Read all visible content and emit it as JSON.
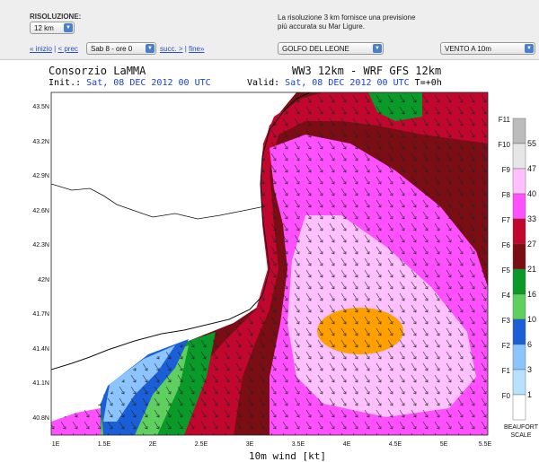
{
  "controls": {
    "resolution_label": "RISOLUZIONE:",
    "resolution_value": "12 km",
    "note_line1": "La risoluzione 3 km fornisce una previsione",
    "note_line2": "più accurata su Mar Ligure.",
    "nav_start": "« inizio",
    "nav_prev": "< prec",
    "time_value": "Sab 8 - ore 0",
    "nav_next": "succ. >",
    "nav_end": "fine»",
    "area_value": "GOLFO DEL LEONE",
    "field_value": "VENTO A 10m"
  },
  "map": {
    "org": "Consorzio LaMMA",
    "model": "WW3 12km - WRF GFS 12km",
    "init_label": "Init.:",
    "init_value": "Sat, 08 DEC 2012   00 UTC",
    "valid_label": "Valid:",
    "valid_value": "Sat, 08 DEC 2012   00 UTC",
    "step": "T=+0h",
    "xlabel": "10m wind [kt]",
    "lat_ticks": [
      "43.5N",
      "43.2N",
      "42.9N",
      "42.6N",
      "42.3N",
      "42N",
      "41.7N",
      "41.4N",
      "41.1N",
      "40.8N"
    ],
    "lon_ticks": [
      "1E",
      "1.5E",
      "2E",
      "2.5E",
      "3E",
      "3.5E",
      "4E",
      "4.5E",
      "5E",
      "5.5E"
    ]
  },
  "legend": {
    "beaufort": [
      "F11",
      "F10",
      "F9",
      "F8",
      "F7",
      "F6",
      "F5",
      "F4",
      "F3",
      "F2",
      "F1",
      "F0"
    ],
    "knots": [
      "55",
      "47",
      "40",
      "33",
      "27",
      "21",
      "16",
      "10",
      "6",
      "3",
      "1"
    ],
    "caption1": "BEAUFORT",
    "caption2": "SCALE",
    "colors": [
      "#bcbcbc",
      "#e6e6e6",
      "#ffc0ff",
      "#ff50ff",
      "#c2072e",
      "#7a0e14",
      "#0a9a2a",
      "#5fd05f",
      "#1a5fd8",
      "#8cc4ff",
      "#b8e0ff",
      "#ffffff"
    ]
  }
}
